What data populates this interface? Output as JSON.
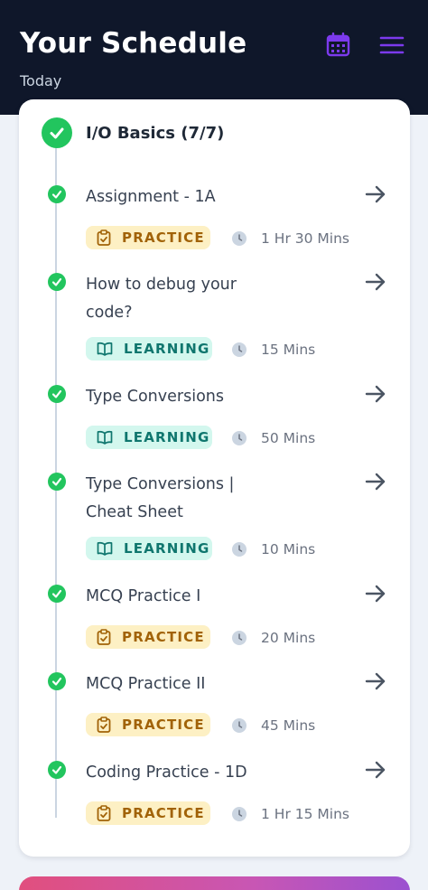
{
  "header": {
    "title": "Your Schedule",
    "subtitle": "Today",
    "calendar_icon": "calendar-icon",
    "menu_icon": "hamburger-menu-icon"
  },
  "section": {
    "title": "I/O Basics (7/7)"
  },
  "colors": {
    "header_bg": "#0f172a",
    "accent_purple": "#7c3aed",
    "complete_green": "#22c55e",
    "practice_bg": "#fdf0c4",
    "practice_text": "#a16207",
    "learning_bg": "#d3f7ee",
    "learning_text": "#0f766e"
  },
  "items": [
    {
      "title": "Assignment - 1A",
      "type": "PRACTICE",
      "duration": "1 Hr 30 Mins"
    },
    {
      "title": "How to debug your code?",
      "type": "LEARNING",
      "duration": "15 Mins"
    },
    {
      "title": "Type Conversions",
      "type": "LEARNING",
      "duration": "50 Mins"
    },
    {
      "title": "Type Conversions | Cheat Sheet",
      "type": "LEARNING",
      "duration": "10 Mins"
    },
    {
      "title": "MCQ Practice I",
      "type": "PRACTICE",
      "duration": "20 Mins"
    },
    {
      "title": "MCQ Practice II",
      "type": "PRACTICE",
      "duration": "45 Mins"
    },
    {
      "title": "Coding Practice - 1D",
      "type": "PRACTICE",
      "duration": "1 Hr 15 Mins"
    }
  ]
}
